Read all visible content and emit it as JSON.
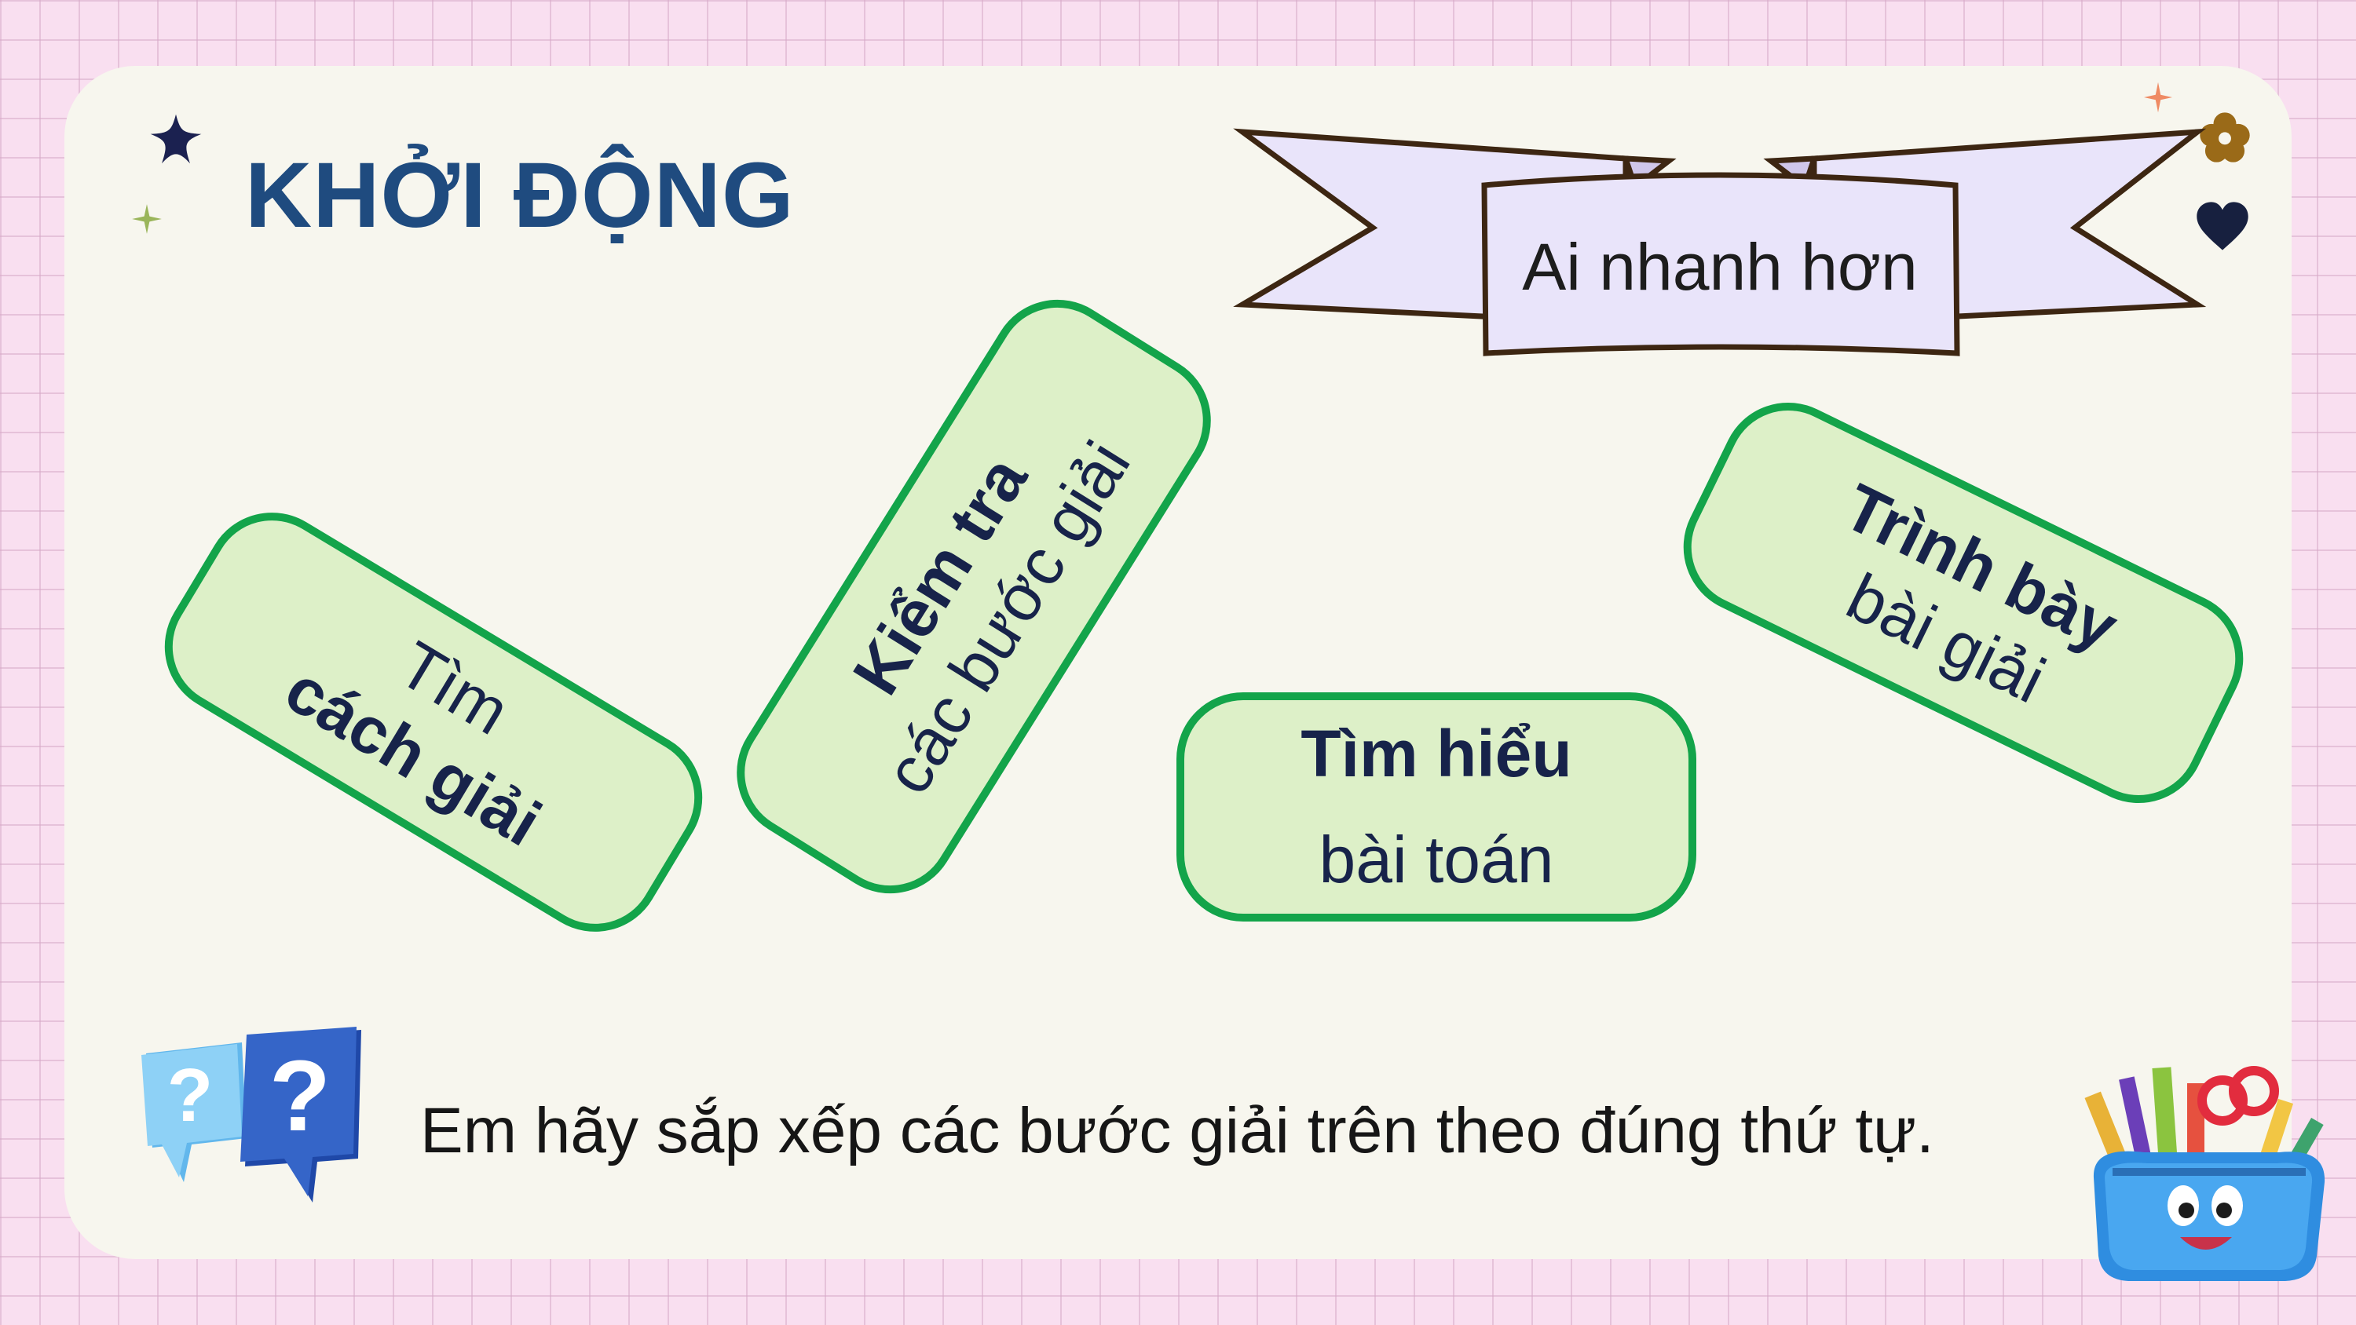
{
  "title": "KHỞI ĐỘNG",
  "banner": {
    "label": "Ai nhanh hơn"
  },
  "cards": [
    {
      "id": "tim-cach-giai",
      "line1": "Tìm",
      "line2": "cách giải"
    },
    {
      "id": "kiem-tra",
      "line1": "Kiểm tra",
      "line2": "các bước giải"
    },
    {
      "id": "tim-hieu",
      "line1": "Tìm hiểu",
      "line2": "bài toán"
    },
    {
      "id": "trinh-bay",
      "line1": "Trình bày",
      "line2": "bài giải"
    }
  ],
  "instruction": "Em hãy sắp xếp các bước giải trên theo đúng thứ tự.",
  "colors": {
    "background": "#f9dff0",
    "board": "#f7f6ee",
    "title": "#1f4b7f",
    "card_fill": "#ddf0c8",
    "card_border": "#13a44a",
    "banner_fill": "#e9e4fa"
  },
  "icons": [
    "star-icon",
    "sparkle-icon",
    "flower-icon",
    "heart-icon",
    "question-bubbles-icon",
    "pencil-case-icon"
  ]
}
